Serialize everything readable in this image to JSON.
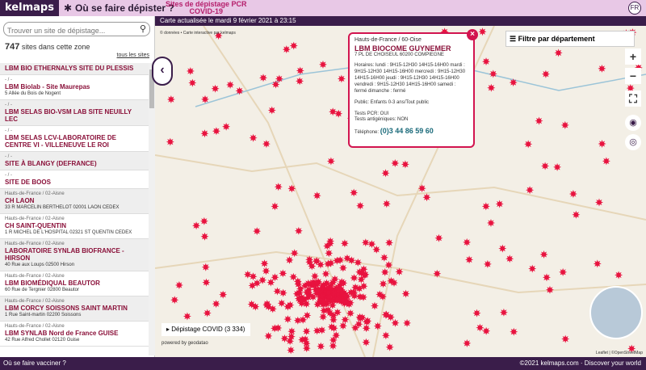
{
  "header": {
    "logo": "kelmaps",
    "where_label": "Où se faire dépister ?",
    "subtitle_1": "Sites de dépistage PCR",
    "subtitle_2": "COVID-19",
    "lang": "FR"
  },
  "update": "Carte actualisée le mardi 9 février 2021 à 23:15",
  "sidebar": {
    "search_placeholder": "Trouver un site de dépistage...",
    "count": "747",
    "count_label": "sites dans cette zone",
    "all_label": "tous les sites",
    "items": [
      {
        "region": "",
        "name": "LBM BIO ETHERNALYS SITE DU PLESSIS",
        "addr": ""
      },
      {
        "region": "- / -",
        "name": "LBM Biolab - Site Maurepas",
        "addr": "5 Allée du Bois de Nogent"
      },
      {
        "region": "- / -",
        "name": "LBM SELAS BIO-VSM LAB SITE NEUILLY LEC",
        "addr": ""
      },
      {
        "region": "- / -",
        "name": "LBM SELAS LCV-LABORATOIRE DE CENTRE VI - VILLENEUVE LE ROI",
        "addr": ""
      },
      {
        "region": "- / -",
        "name": "SITE À BLANGY (DEFRANCE)",
        "addr": ""
      },
      {
        "region": "- / -",
        "name": "SITE DE BOOS",
        "addr": ""
      },
      {
        "region": "Hauts-de-France / 02-Aisne",
        "name": "CH LAON",
        "addr": "33 R MARCELIN BERTHELOT 02001 LAON CEDEX"
      },
      {
        "region": "Hauts-de-France / 02-Aisne",
        "name": "CH SAINT-QUENTIN",
        "addr": "1 R MICHEL DE L'HOSPITAL 02321 ST QUENTIN CEDEX"
      },
      {
        "region": "Hauts-de-France / 02-Aisne",
        "name": "LABORATOIRE SYNLAB BIOFRANCE - HIRSON",
        "addr": "40 Rue aux Loups 02500 Hirson"
      },
      {
        "region": "Hauts-de-France / 02-Aisne",
        "name": "LBM BIOMÉDIQUAL BEAUTOR",
        "addr": "60 Rue de Tergnier 02800 Beautor"
      },
      {
        "region": "Hauts-de-France / 02-Aisne",
        "name": "LBM CORCY SOISSONS SAINT MARTIN",
        "addr": "1 Rue Saint-martin 02200 Soissons"
      },
      {
        "region": "Hauts-de-France / 02-Aisne",
        "name": "LBM SYNLAB Nord de France GUISE",
        "addr": "42 Rue Alfred Chollet 02120 Guise"
      }
    ]
  },
  "popup": {
    "region": "Hauts-de-France / 60-Oise",
    "name": "LBM BIOCOME GUYNEMER",
    "addr": "7 PL DE CHOISEUL 60200 COMPIEGNE",
    "hours": "Horaires: lundi : 9H15-12H30 14H15-16H00 mardi : 9H15-12H30 14H15-16H00 mercredi : 9H15-12H30 14H15-16H00 jeudi : 9H15-12H30 14H15-16H00 vendredi : 9H15-12H30 14H15-16H00 samedi : fermé dimanche : fermé",
    "public": "Public: Enfants 0-3 ans/Tout public",
    "pcr": "Tests PCR: OUI",
    "antigen": "Tests antigéniques: NON",
    "tel_label": "Téléphone:",
    "tel": "(0)3 44 86 59 60"
  },
  "filter_label": "Filtre par département",
  "covid_label": "Dépistage COVID",
  "covid_count": "(3 334)",
  "attrib": "© données • Carte interactive par kelmaps",
  "powered": "powered by geodatao",
  "leaflet": "Leaflet | ©OpenStreetMap",
  "footer": {
    "left": "Où se faire vacciner ?",
    "right": "©2021 kelmaps.com · Discover your world"
  }
}
